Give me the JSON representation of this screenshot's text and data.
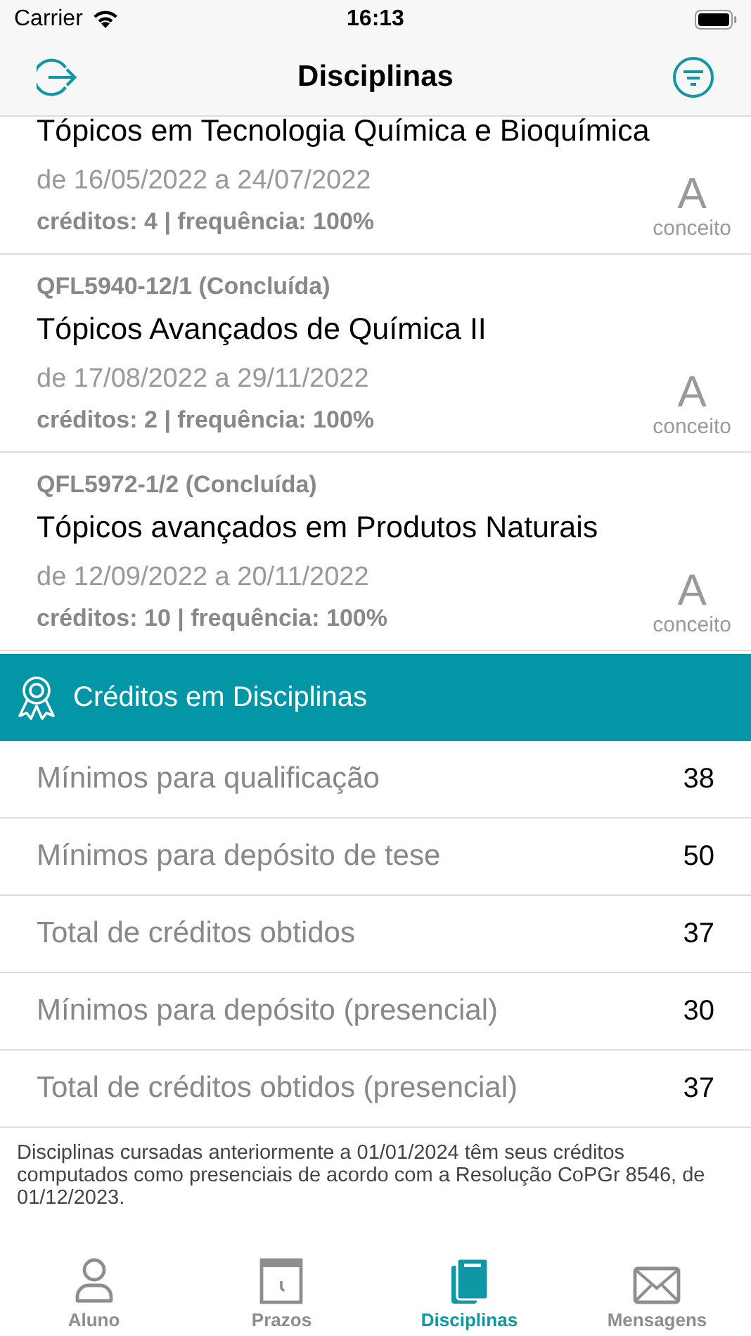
{
  "status_bar": {
    "carrier": "Carrier",
    "time": "16:13"
  },
  "nav": {
    "title": "Disciplinas"
  },
  "courses": [
    {
      "title": "Tópicos em Tecnologia Química e Bioquímica",
      "dates": "de 16/05/2022 a 24/07/2022",
      "details": "créditos: 4 | frequência: 100%",
      "grade": "A",
      "grade_label": "conceito"
    },
    {
      "code": "QFL5940-12/1 (Concluída)",
      "title": "Tópicos Avançados de Química II",
      "dates": "de 17/08/2022 a 29/11/2022",
      "details": "créditos: 2 | frequência: 100%",
      "grade": "A",
      "grade_label": "conceito"
    },
    {
      "code": "QFL5972-1/2 (Concluída)",
      "title": "Tópicos avançados em Produtos Naturais",
      "dates": "de 12/09/2022 a 20/11/2022",
      "details": "créditos: 10 | frequência: 100%",
      "grade": "A",
      "grade_label": "conceito"
    }
  ],
  "credits_section": {
    "title": "Créditos em Disciplinas",
    "rows": [
      {
        "label": "Mínimos para qualificação",
        "value": "38"
      },
      {
        "label": "Mínimos para depósito de tese",
        "value": "50"
      },
      {
        "label": "Total de créditos obtidos",
        "value": "37"
      },
      {
        "label": "Mínimos para depósito (presencial)",
        "value": "30"
      },
      {
        "label": "Total de créditos obtidos (presencial)",
        "value": "37"
      }
    ]
  },
  "footnote": "Disciplinas cursadas anteriormente a 01/01/2024 têm seus créditos computados como presenciais de acordo com a Resolução CoPGr 8546, de 01/12/2023.",
  "tab_bar": [
    {
      "kind": "person",
      "label": "Aluno",
      "selected": false
    },
    {
      "kind": "calendar",
      "label": "Prazos",
      "selected": false
    },
    {
      "kind": "book",
      "label": "Disciplinas",
      "selected": true
    },
    {
      "kind": "envelope",
      "label": "Mensagens",
      "selected": false
    }
  ]
}
